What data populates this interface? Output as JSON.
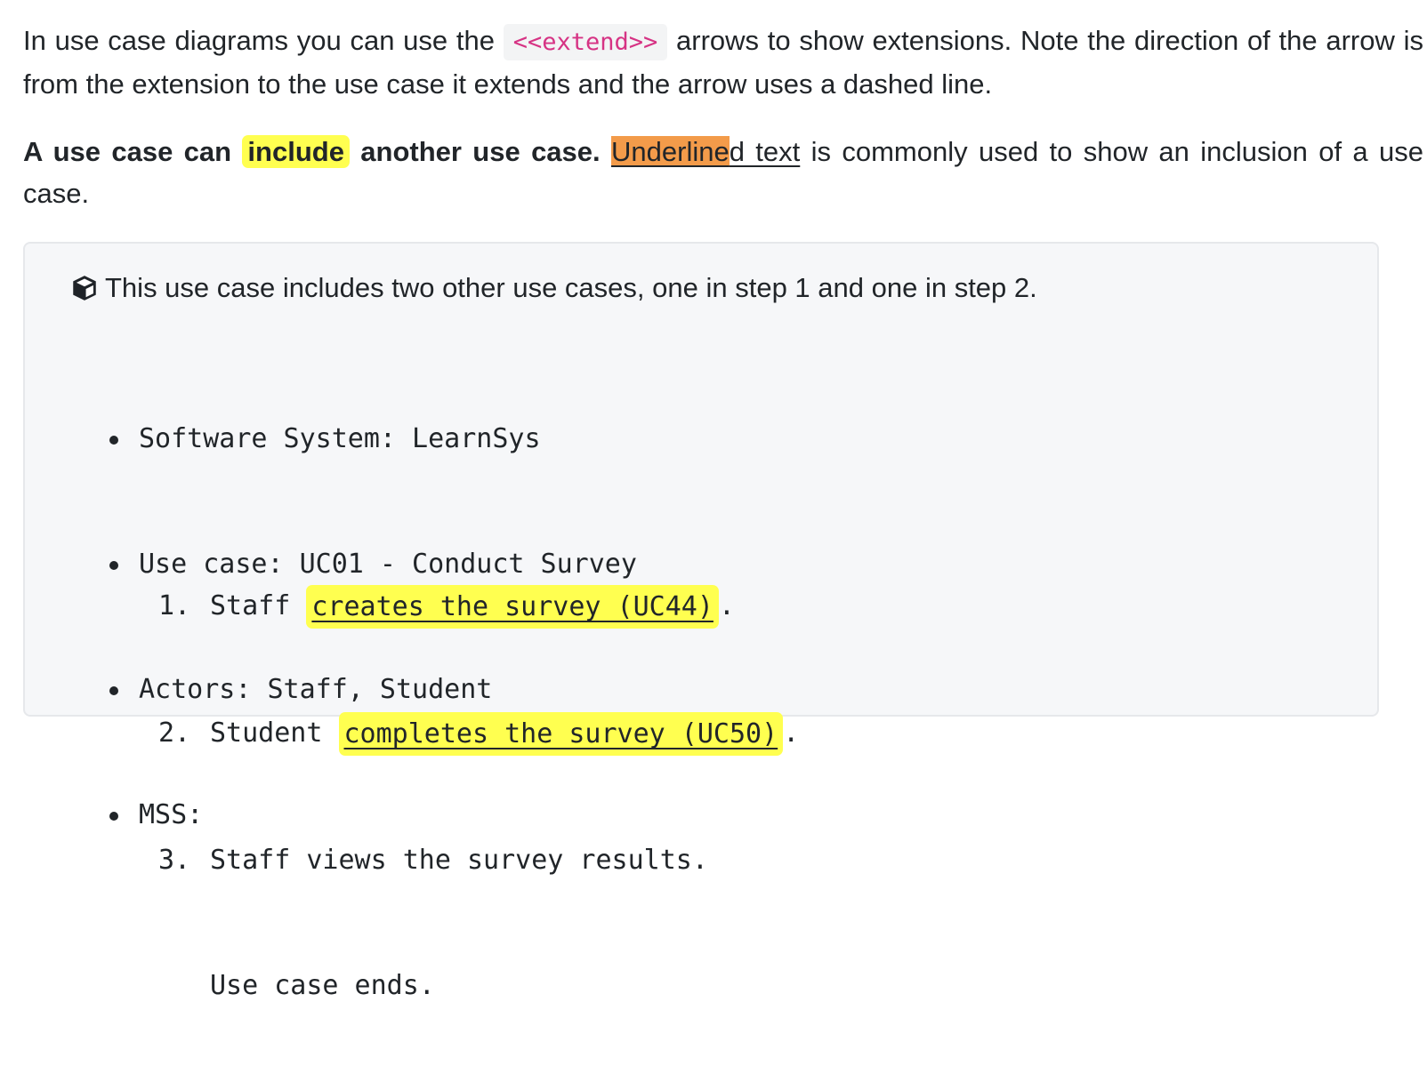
{
  "para1": {
    "before": "In use case diagrams you can use the ",
    "code": "<<extend>>",
    "after": " arrows to show extensions. Note the direction of the arrow is from the extension to the use case it extends and the arrow uses a dashed line."
  },
  "para2": {
    "bold_before": "A use case can ",
    "bold_highlight": "include",
    "bold_after": " another use case.",
    "underline_highlighted": "Underline",
    "underline_rest": "d text",
    "after": " is commonly used to show an inclusion of a use case."
  },
  "example": {
    "icon": "box-icon",
    "intro": "This use case includes two other use cases, one in step 1 and one in step 2.",
    "facts": [
      "Software System: LearnSys",
      "Use case: UC01 - Conduct Survey",
      "Actors: Staff, Student",
      "MSS:"
    ],
    "steps": [
      {
        "num": "1.",
        "before": "Staff ",
        "link": "creates the survey (UC44)",
        "after": "."
      },
      {
        "num": "2.",
        "before": "Student ",
        "link": "completes the survey (UC50)",
        "after": "."
      },
      {
        "num": "3.",
        "before": "Staff views the survey results.",
        "link": "",
        "after": ""
      }
    ],
    "ending": "Use case ends."
  },
  "colors": {
    "highlight_yellow": "#ffff50",
    "highlight_orange": "#f39b4a",
    "code_text": "#d63384",
    "box_background": "#f6f7f9"
  }
}
